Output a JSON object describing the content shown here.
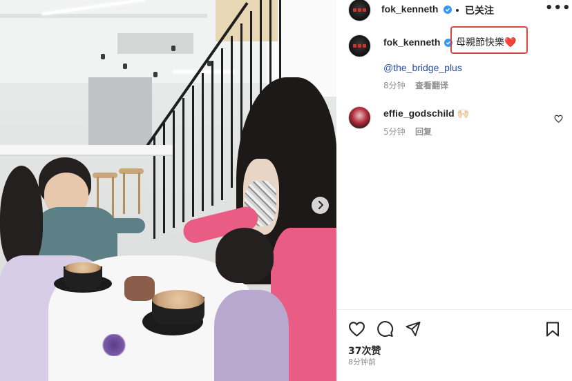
{
  "post": {
    "author": "fok_kenneth",
    "follow_status": "已关注",
    "more_menu": "•••",
    "caption": "母親節快樂",
    "caption_emoji": "❤️",
    "mention": "@the_bridge_plus",
    "caption_time": "8分钟",
    "translate_label": "查看翻译",
    "likes": "37次赞",
    "posted_time": "8分钟前"
  },
  "comments": [
    {
      "username": "effie_godschild",
      "text": "🙌🏻",
      "time": "5分钟",
      "reply_label": "回复"
    }
  ],
  "icons": {
    "verified": "verified-badge-icon",
    "like": "heart-icon",
    "comment": "comment-bubble-icon",
    "share": "paper-plane-icon",
    "save": "bookmark-icon",
    "comment_like": "small-heart-icon",
    "carousel_next": "chevron-right-icon"
  },
  "colors": {
    "highlight_box": "#d9473a",
    "verified": "#3897f0",
    "mention": "#2a4ea3",
    "heart": "#e0245e",
    "muted_text": "#8e8e8e"
  }
}
